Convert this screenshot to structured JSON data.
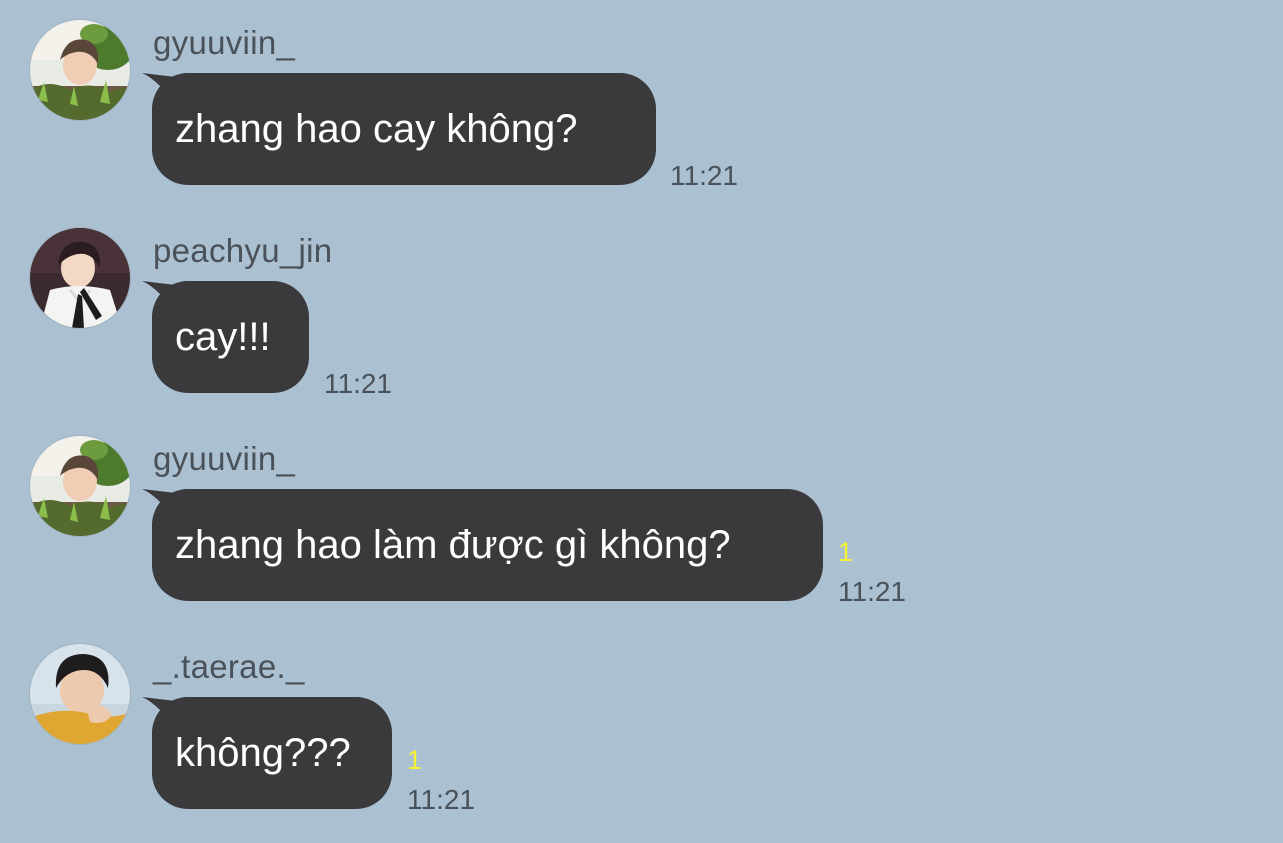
{
  "chat": {
    "messages": [
      {
        "sender": "gyuuviin_",
        "avatar": "avatar-photo-gyuuviin",
        "text": "zhang hao cay không?",
        "time": "11:21",
        "unread": ""
      },
      {
        "sender": "peachyu_jin",
        "avatar": "avatar-photo-peachyu-jin",
        "text": "cay!!!",
        "time": "11:21",
        "unread": ""
      },
      {
        "sender": "gyuuviin_",
        "avatar": "avatar-photo-gyuuviin",
        "text": "zhang hao làm được gì không?",
        "time": "11:21",
        "unread": "1"
      },
      {
        "sender": "_.taerae._",
        "avatar": "avatar-photo-taerae",
        "text": "không???",
        "time": "11:21",
        "unread": "1"
      }
    ]
  },
  "colors": {
    "background": "#abc1d1",
    "bubble": "#3a3a3c",
    "bubble_text": "#ffffff",
    "meta_text": "#4a5158",
    "unread": "#f4f232"
  }
}
